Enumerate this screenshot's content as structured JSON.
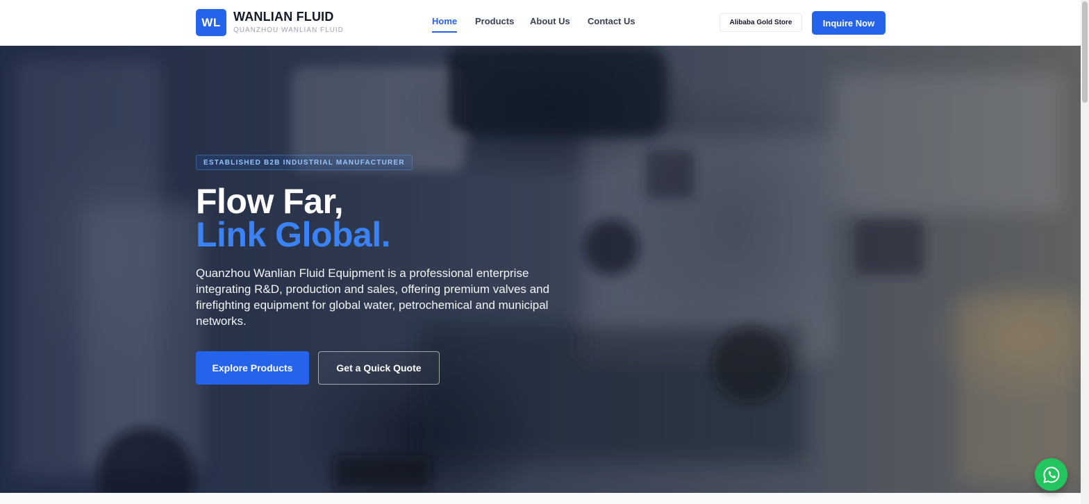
{
  "header": {
    "logo_mark": "WL",
    "brand_name": "WANLIAN FLUID",
    "brand_sub": "QUANZHOU WANLIAN FLUID",
    "nav": [
      {
        "label": "Home",
        "active": true
      },
      {
        "label": "Products",
        "active": false
      },
      {
        "label": "About Us",
        "active": false
      },
      {
        "label": "Contact Us",
        "active": false
      }
    ],
    "store_label": "Alibaba Gold Store",
    "inquire_label": "Inquire Now"
  },
  "hero": {
    "badge": "ESTABLISHED B2B INDUSTRIAL MANUFACTURER",
    "headline_line1": "Flow Far,",
    "headline_line2": "Link Global.",
    "description": "Quanzhou Wanlian Fluid Equipment is a professional enterprise integrating R&D, production and sales, offering premium valves and firefighting equipment for global water, petrochemical and municipal networks.",
    "primary_cta": "Explore Products",
    "secondary_cta": "Get a Quick Quote"
  },
  "floating": {
    "icon": "whatsapp-icon"
  },
  "colors": {
    "accent": "#2563eb",
    "accent_light": "#3b82f6",
    "whatsapp": "#22c55e",
    "text_dark": "#111827"
  }
}
